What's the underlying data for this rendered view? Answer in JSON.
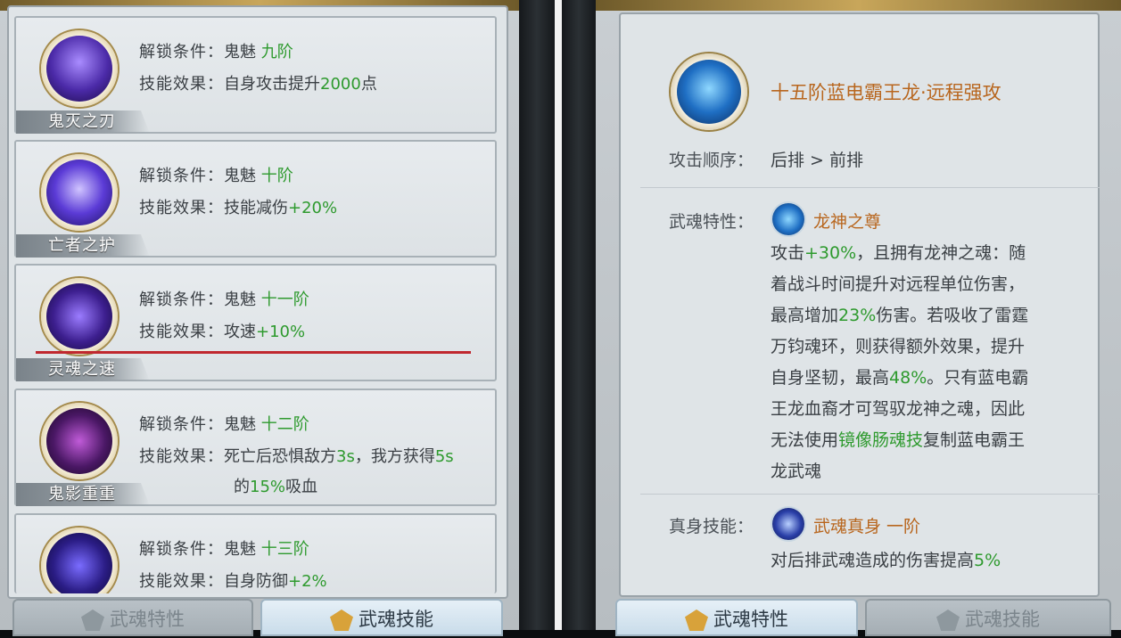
{
  "left": {
    "unlock_label": "解锁条件：",
    "effect_label": "技能效果：",
    "skills": [
      {
        "name": "鬼灭之刃",
        "unlock_base": "鬼魅",
        "unlock_tier": "九阶",
        "effect_plain": "自身攻击提升",
        "effect_value": "2000",
        "effect_suffix": "点"
      },
      {
        "name": "亡者之护",
        "unlock_base": "鬼魅",
        "unlock_tier": "十阶",
        "effect_plain": "技能减伤",
        "effect_value": "+20%"
      },
      {
        "name": "灵魂之速",
        "unlock_base": "鬼魅",
        "unlock_tier": "十一阶",
        "effect_plain": "攻速",
        "effect_value": "+10%"
      },
      {
        "name": "鬼影重重",
        "unlock_base": "鬼魅",
        "unlock_tier": "十二阶",
        "effect_a": "死亡后恐惧敌方",
        "effect_v1": "3s",
        "effect_b": "，我方获得",
        "effect_v2": "5s",
        "effect_c": "的",
        "effect_v3": "15%",
        "effect_d": "吸血"
      },
      {
        "name": "",
        "unlock_base": "鬼魅",
        "unlock_tier": "十三阶",
        "effect_plain": "自身防御",
        "effect_value": "+2%"
      }
    ],
    "tabs": [
      "武魂特性",
      "武魂技能"
    ]
  },
  "right": {
    "title": "十五阶蓝电霸王龙·远程强攻",
    "order_label": "攻击顺序：",
    "order_value": "后排 > 前排",
    "trait_label": "武魂特性：",
    "trait_name": "龙神之尊",
    "trait_lines": [
      {
        "a": "攻击",
        "g": "+30%",
        "b": "，且拥有龙神之魂：随"
      },
      {
        "a": "着战斗时间提升对远程单位伤害，",
        "g": "",
        "b": ""
      },
      {
        "a": "最高增加",
        "g": "23%",
        "b": "伤害。若吸收了雷霆"
      },
      {
        "a": "万钧魂环，则获得额外效果，提升",
        "g": "",
        "b": ""
      },
      {
        "a": "自身坚韧，最高",
        "g": "48%",
        "b": "。只有蓝电霸"
      },
      {
        "a": "王龙血裔才可驾驭龙神之魂，因此",
        "g": "",
        "b": ""
      },
      {
        "a": "无法使用",
        "g": "镜像肠魂技",
        "b": "复制蓝电霸王"
      },
      {
        "a": "龙武魂",
        "g": "",
        "b": ""
      }
    ],
    "true_label": "真身技能：",
    "true_name": "武魂真身 一阶",
    "true_desc": "对后排武魂造成的伤害提高",
    "true_value": "5%",
    "tabs": [
      "武魂特性",
      "武魂技能"
    ]
  },
  "colors": {
    "green": "#2e9a2e",
    "orange": "#b8661e",
    "underline": "#c0282f"
  }
}
